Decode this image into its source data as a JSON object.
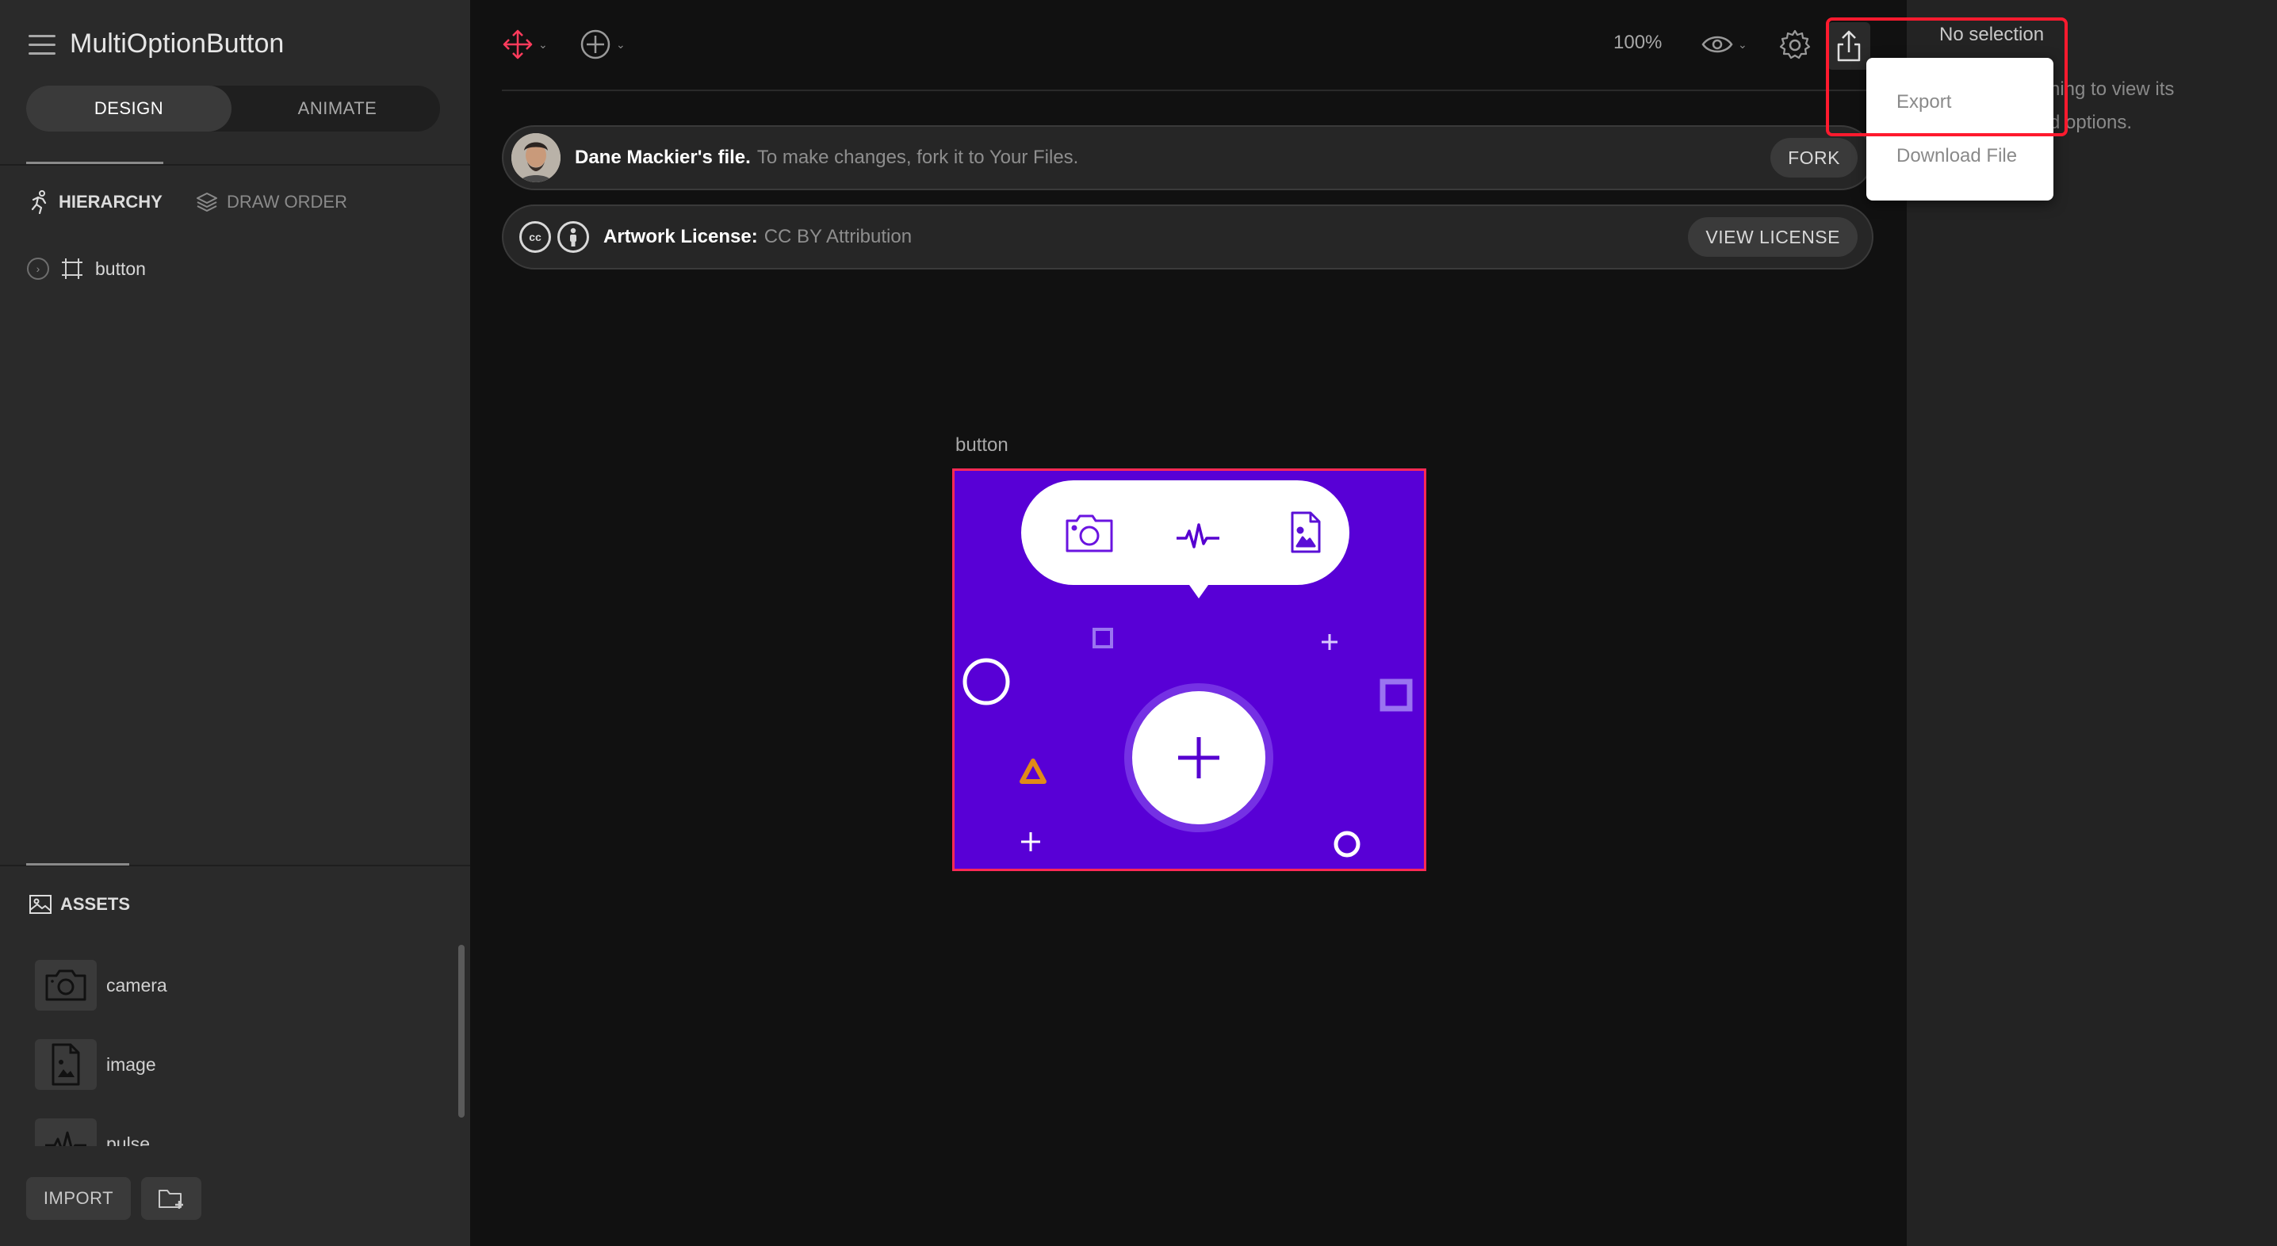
{
  "app": {
    "file_title": "MultiOptionButton"
  },
  "mode_tabs": {
    "design": "DESIGN",
    "animate": "ANIMATE"
  },
  "panel_tabs": {
    "hierarchy": "HIERARCHY",
    "draw_order": "DRAW ORDER"
  },
  "hierarchy": {
    "items": [
      {
        "label": "button",
        "icon": "artboard-icon"
      }
    ]
  },
  "assets": {
    "title": "ASSETS",
    "items": [
      {
        "label": "camera",
        "icon": "camera-icon"
      },
      {
        "label": "image",
        "icon": "image-file-icon"
      },
      {
        "label": "pulse",
        "icon": "pulse-icon"
      }
    ],
    "import_label": "IMPORT"
  },
  "toolbar": {
    "zoom": "100%"
  },
  "banners": {
    "owner": {
      "lead": "Dane Mackier's file.",
      "rest": "To make changes, fork it to Your Files.",
      "button": "FORK"
    },
    "license": {
      "lead": "Artwork License:",
      "rest": "CC BY Attribution",
      "button": "VIEW LICENSE"
    }
  },
  "artboard": {
    "label": "button",
    "background": "#5800d6",
    "selection_color": "#ff2a55"
  },
  "right_panel": {
    "no_selection": "No selection",
    "hint_line1": "hing to view its",
    "hint_line2": "d options."
  },
  "export_menu": {
    "items": [
      "Export",
      "Download File"
    ]
  },
  "colors": {
    "accent_red": "#ff1a2e",
    "move_tool": "#ff3b5c"
  }
}
